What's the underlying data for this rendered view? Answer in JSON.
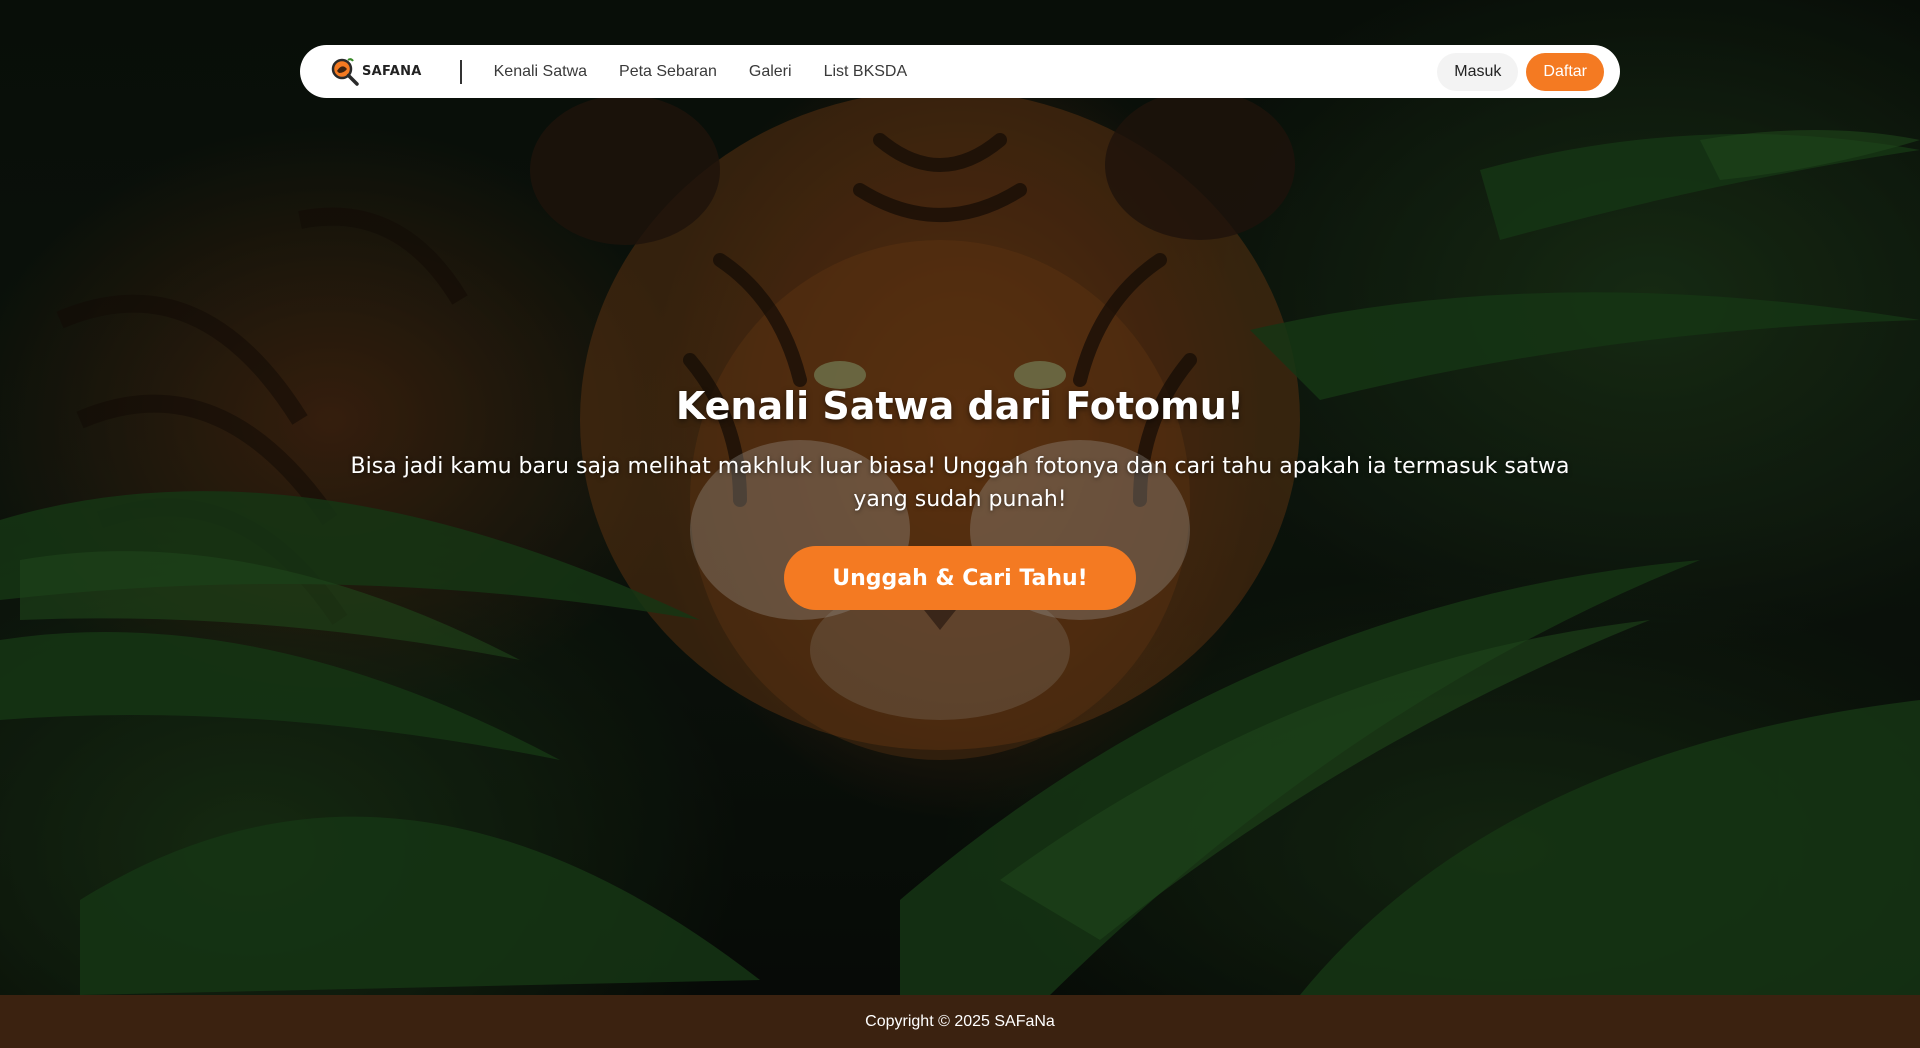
{
  "brand": {
    "logo_text": "SAFANA",
    "accent_color": "#f47a22",
    "footer_color": "#3b2210"
  },
  "nav": {
    "links": [
      "Kenali Satwa",
      "Peta Sebaran",
      "Galeri",
      "List BKSDA"
    ],
    "login_label": "Masuk",
    "register_label": "Daftar"
  },
  "hero": {
    "title": "Kenali Satwa dari Fotomu!",
    "subtitle": "Bisa jadi kamu baru saja melihat makhluk luar biasa! Unggah fotonya dan cari tahu apakah ia termasuk satwa yang sudah punah!",
    "cta_label": "Unggah & Cari Tahu!",
    "background_image": "tiger-in-jungle"
  },
  "footer": {
    "copyright": "Copyright © 2025 SAFaNa"
  }
}
